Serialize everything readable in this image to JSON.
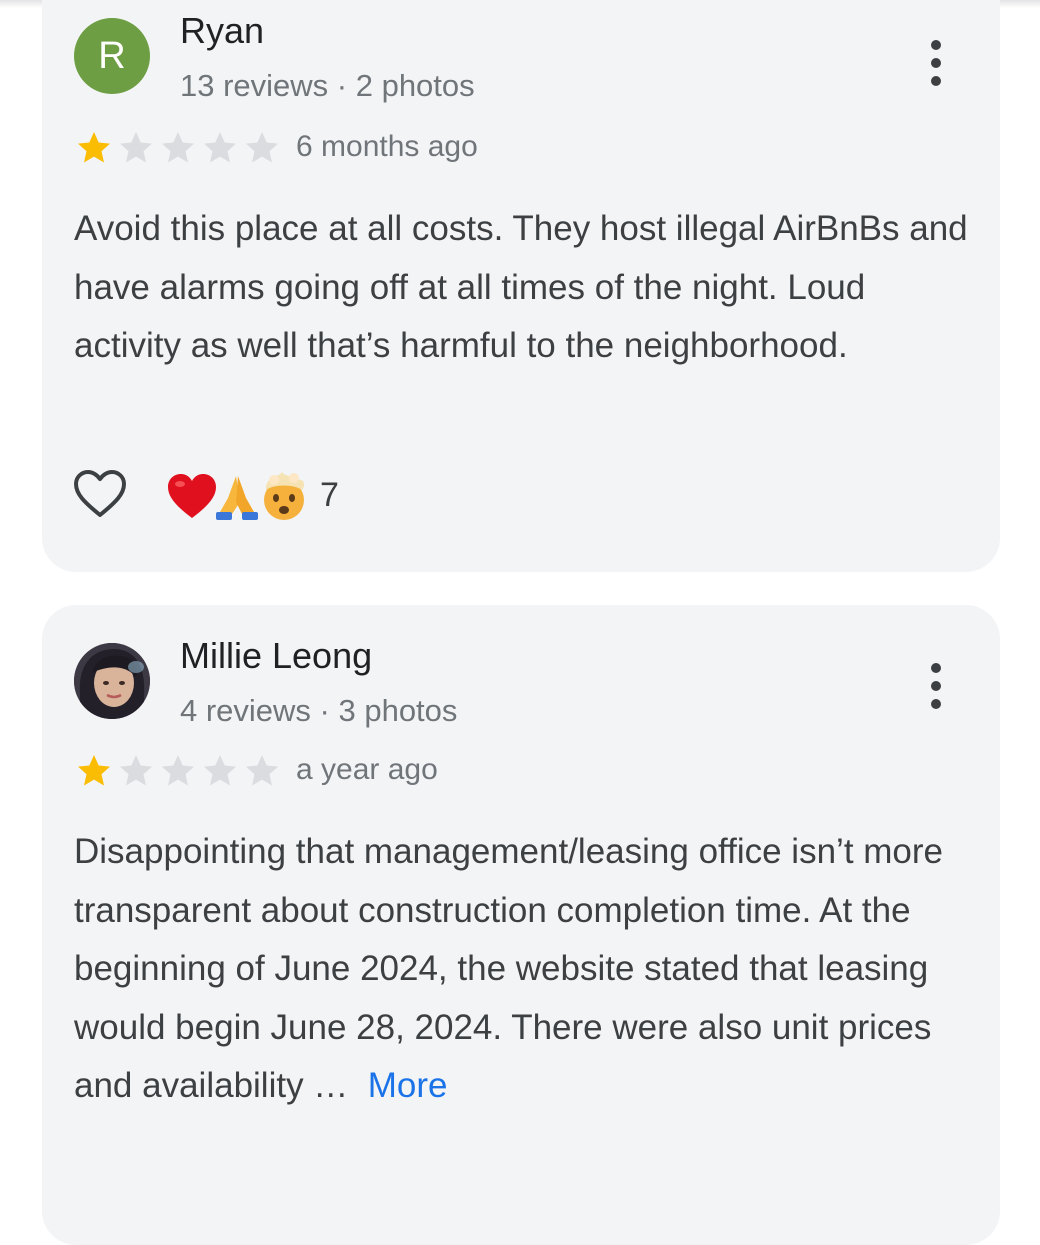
{
  "reviews": [
    {
      "avatar_letter": "R",
      "avatar_color": "#6e9e43",
      "name": "Ryan",
      "meta": "13 reviews · 2 photos",
      "rating": 1,
      "max_rating": 5,
      "time": "6 months ago",
      "text": "Avoid this place at all costs. They host illegal AirBnBs and have alarms going off at all times of the night. Loud activity as well that’s harmful to the neighborhood.",
      "reactions": [
        "red-heart",
        "folded-hands",
        "exploding-head"
      ],
      "reaction_count": "7"
    },
    {
      "name": "Millie Leong",
      "meta": "4 reviews · 3 photos",
      "rating": 1,
      "max_rating": 5,
      "time": "a year ago",
      "text": "Disappointing that management/leasing office isn’t more transparent about construction completion time. At the beginning of June 2024, the website stated that leasing would begin June 28, 2024. There were also unit prices and availability …",
      "more_label": "More"
    }
  ],
  "colors": {
    "card_bg": "#f3f4f6",
    "star_filled": "#fbbc04",
    "star_empty": "#dadce0",
    "link": "#1a73e8"
  }
}
